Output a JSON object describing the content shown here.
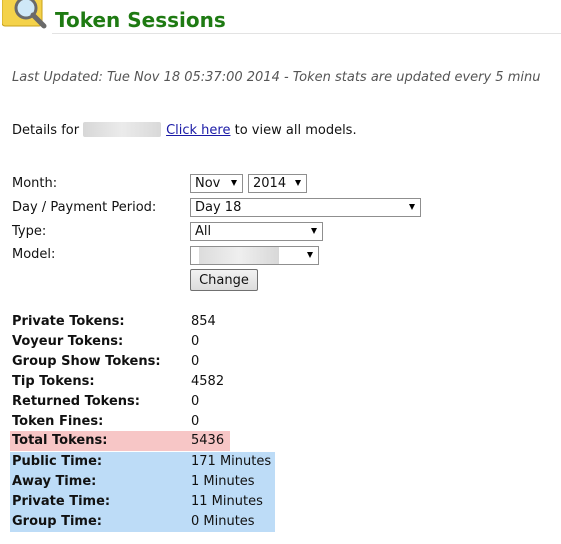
{
  "header": {
    "title": "Token Sessions",
    "last_updated": "Last Updated: Tue Nov 18 05:37:00 2014 - Token stats are updated every 5 minu"
  },
  "details": {
    "prefix": "Details for",
    "link": "Click here",
    "suffix": "to view all models."
  },
  "form": {
    "month_label": "Month:",
    "month_value": "Nov",
    "year_value": "2014",
    "period_label": "Day / Payment Period:",
    "period_value": "Day 18",
    "type_label": "Type:",
    "type_value": "All",
    "model_label": "Model:",
    "change_button": "Change"
  },
  "stats": [
    {
      "label": "Private Tokens:",
      "value": "854"
    },
    {
      "label": "Voyeur Tokens:",
      "value": "0"
    },
    {
      "label": "Group Show Tokens:",
      "value": "0"
    },
    {
      "label": "Tip Tokens:",
      "value": "4582"
    },
    {
      "label": "Returned Tokens:",
      "value": "0"
    },
    {
      "label": "Token Fines:",
      "value": "0"
    },
    {
      "label": "Total Tokens:",
      "value": "5436"
    },
    {
      "label": "Public Time:",
      "value": "171 Minutes"
    },
    {
      "label": "Away Time:",
      "value": "1 Minutes"
    },
    {
      "label": "Private Time:",
      "value": "11 Minutes"
    },
    {
      "label": "Group Time:",
      "value": "0 Minutes"
    }
  ],
  "colors": {
    "title": "#1e7a12",
    "total_highlight": "#f7c6c6",
    "time_highlight": "#bddcf7",
    "link": "#1a1aa6"
  },
  "icons": {
    "logo": "magnifier-icon"
  }
}
